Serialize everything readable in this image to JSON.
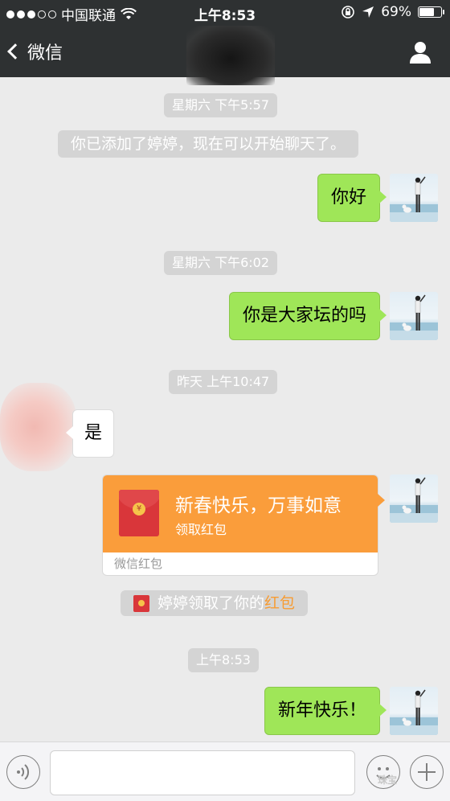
{
  "status_bar": {
    "carrier": "中国联通",
    "time": "上午8:53",
    "battery": "69%",
    "battery_level": 0.69,
    "signal_bars_filled": 3,
    "signal_bars_total": 5
  },
  "nav": {
    "back_label": "微信",
    "back_icon": "chevron-left-icon",
    "profile_icon": "person-icon"
  },
  "chat": {
    "timestamps": [
      "星期六 下午5:57",
      "星期六 下午6:02",
      "昨天 上午10:47",
      "上午8:53"
    ],
    "system_added": "你已添加了婷婷，现在可以开始聊天了。",
    "messages": [
      {
        "side": "right",
        "text": "你好"
      },
      {
        "side": "right",
        "text": "你是大家坛的吗"
      },
      {
        "side": "left",
        "text": "是"
      },
      {
        "side": "right",
        "text": "新年快乐！"
      }
    ],
    "red_packet": {
      "title": "新春快乐，万事如意",
      "subtitle": "领取红包",
      "footer": "微信红包",
      "coin_symbol": "¥"
    },
    "red_packet_notice": {
      "prefix": "婷婷领取了你的",
      "link": "红包"
    }
  },
  "input_bar": {
    "voice_icon": "voice-icon",
    "emoji_icon": "emoji-icon",
    "plus_icon": "plus-icon",
    "input_value": "",
    "watermark": "珠宝"
  },
  "colors": {
    "nav_bg": "#2e3132",
    "chat_bg": "#ebebeb",
    "bubble_green": "#9fe658",
    "red_packet_orange": "#fa9d3b",
    "link_orange": "#f79c33"
  }
}
